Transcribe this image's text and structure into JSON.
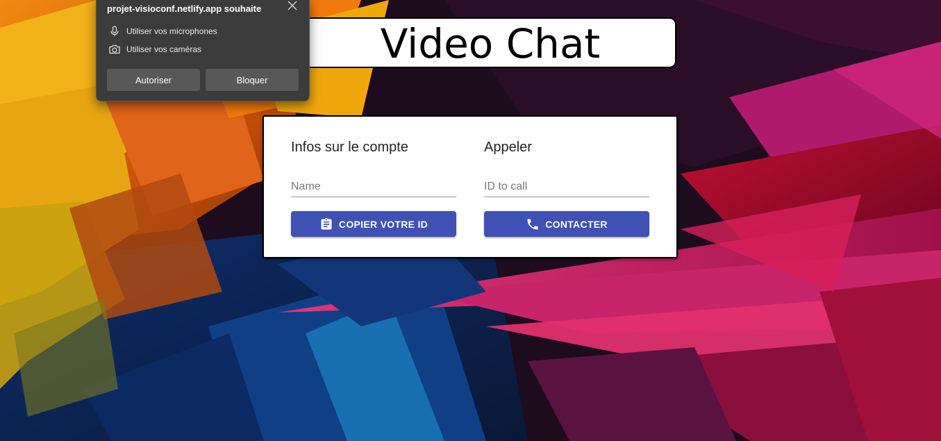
{
  "app": {
    "title": "Video Chat"
  },
  "account": {
    "heading": "Infos sur le compte",
    "name_placeholder": "Name",
    "copy_button_label": "COPIER VOTRE ID",
    "copy_icon": "clipboard-icon"
  },
  "call": {
    "heading": "Appeler",
    "id_placeholder": "ID to call",
    "contact_button_label": "CONTACTER",
    "phone_icon": "phone-icon"
  },
  "permission_prompt": {
    "title": "projet-visioconf.netlify.app souhaite",
    "items": [
      {
        "icon": "microphone-icon",
        "label": "Utiliser vos microphones"
      },
      {
        "icon": "camera-icon",
        "label": "Utiliser vos caméras"
      }
    ],
    "allow_label": "Autoriser",
    "block_label": "Bloquer"
  },
  "colors": {
    "primary_button": "#3f51b5",
    "popup_background": "#3b3b3b",
    "popup_button": "#585858"
  }
}
